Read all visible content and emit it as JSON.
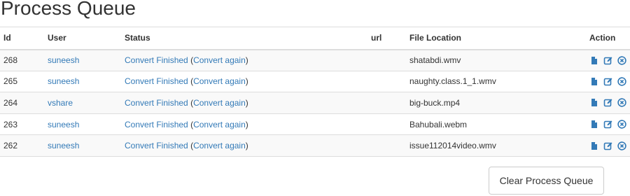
{
  "page": {
    "title": "Process Queue"
  },
  "table": {
    "headers": {
      "id": "Id",
      "user": "User",
      "status": "Status",
      "url": "url",
      "file_location": "File Location",
      "action": "Action"
    },
    "rows": [
      {
        "id": "268",
        "user": "suneesh",
        "status": "Convert Finished",
        "reconvert": "Convert again",
        "url": "",
        "file": "shatabdi.wmv"
      },
      {
        "id": "265",
        "user": "suneesh",
        "status": "Convert Finished",
        "reconvert": "Convert again",
        "url": "",
        "file": "naughty.class.1_1.wmv"
      },
      {
        "id": "264",
        "user": "vshare",
        "status": "Convert Finished",
        "reconvert": "Convert again",
        "url": "",
        "file": "big-buck.mp4"
      },
      {
        "id": "263",
        "user": "suneesh",
        "status": "Convert Finished",
        "reconvert": "Convert again",
        "url": "",
        "file": "Bahubali.webm"
      },
      {
        "id": "262",
        "user": "suneesh",
        "status": "Convert Finished",
        "reconvert": "Convert again",
        "url": "",
        "file": "issue112014video.wmv"
      }
    ],
    "action_icons": [
      "file-icon",
      "edit-icon",
      "remove-circle-icon"
    ]
  },
  "footer": {
    "clear_button": "Clear Process Queue"
  },
  "colors": {
    "link": "#337ab7",
    "text": "#333333",
    "border": "#dddddd",
    "stripe": "#f9f9f9"
  }
}
